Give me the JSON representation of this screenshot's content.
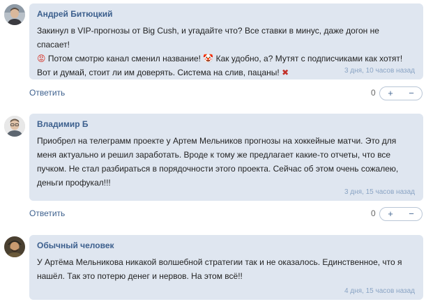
{
  "comments": [
    {
      "author": "Андрей Битюцкий",
      "avatar_icon": "man-avatar-icon",
      "text_1": "Закинул в VIP-прогнозы от Big Cush, и угадайте что? Все ставки в минус, даже догон не спасает!",
      "emoji_angry": "😡",
      "text_2": " Потом смотрю канал сменил название!",
      "emoji_face": "🤡",
      "text_3": " Как удобно, а? Мутят с подписчиками как хотят! Вот и думай, стоит ли им доверять. Система на слив, пацаны!",
      "emoji_cross": "✖",
      "time": "3 дня, 10 часов назад",
      "reply_label": "Ответить",
      "score": "0",
      "plus_label": "+",
      "minus_label": "−"
    },
    {
      "author": "Владимир Б",
      "avatar_icon": "man-with-glasses-avatar-icon",
      "text": "Приобрел на телеграмм проекте у Артем Мельников прогнозы на хоккейные матчи. Это для меня актуально и решил заработать. Вроде к тому же предлагает какие-то отчеты, что все пучком. Не стал разбираться в порядочности этого проекта. Сейчас об этом очень сожалею, деньги профукал!!!",
      "time": "3 дня, 15 часов назад",
      "reply_label": "Ответить",
      "score": "0",
      "plus_label": "+",
      "minus_label": "−"
    },
    {
      "author": "Обычный человек",
      "avatar_icon": "man-in-cap-avatar-icon",
      "text": "У Артёма Мельникова никакой волшебной стратегии так и не оказалось. Единственное, что я нашёл. Так это потерю денег и нервов. На этом всё!!",
      "time": "4 дня, 15 часов назад"
    }
  ],
  "colors": {
    "bubble_bg": "#dfe6f0",
    "author": "#3c5f8d",
    "time": "#8aa4c4",
    "link": "#3c5f8d"
  }
}
